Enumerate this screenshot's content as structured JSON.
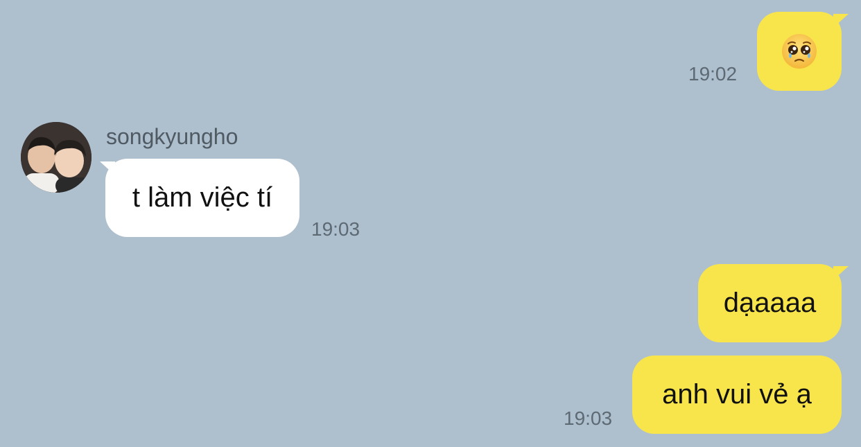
{
  "messages": [
    {
      "sender": "me",
      "type": "emoji",
      "emoji": "pleading-face",
      "time": "19:02"
    },
    {
      "sender": "songkyungho",
      "text": "t làm việc tí",
      "time": "19:03"
    },
    {
      "sender": "me",
      "text": "dạaaaa"
    },
    {
      "sender": "me",
      "text": "anh vui vẻ ạ",
      "time": "19:03"
    }
  ],
  "contact": {
    "name": "songkyungho",
    "avatar": "avatar-photo-two-people"
  },
  "colors": {
    "background": "#aebfce",
    "my_bubble": "#f8e54b",
    "their_bubble": "#ffffff",
    "timestamp": "#5d6a74"
  }
}
